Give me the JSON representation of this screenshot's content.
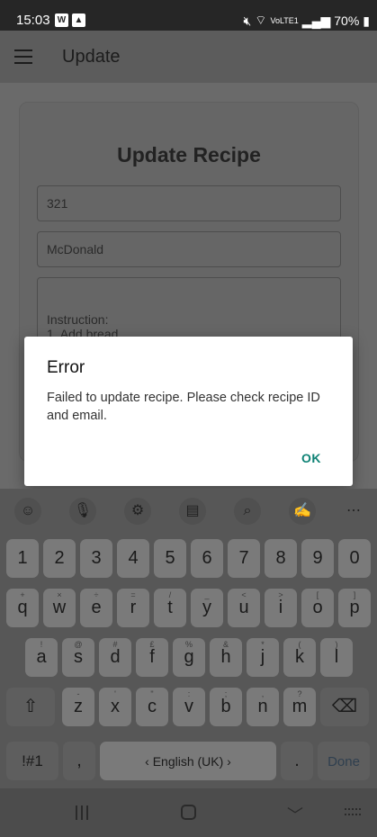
{
  "status_bar": {
    "time": "15:03",
    "left_icons": [
      "app-notification-icon",
      "gallery-icon"
    ],
    "volte": "VoLTE1",
    "battery": "70%"
  },
  "app_bar": {
    "title": "Update"
  },
  "form": {
    "heading": "Update Recipe",
    "recipe_id": "321",
    "email": "McDonald",
    "instructions_line1": "Instruction:",
    "instructions_line2": "1. Add bread"
  },
  "dialog": {
    "title": "Error",
    "message": "Failed to update recipe. Please check recipe ID and email.",
    "ok_label": "OK"
  },
  "keyboard": {
    "toolbar": [
      "emoji-icon",
      "mic-icon",
      "settings-icon",
      "clipboard-icon",
      "search-icon",
      "handwriting-icon",
      "more-icon"
    ],
    "number_row": [
      "1",
      "2",
      "3",
      "4",
      "5",
      "6",
      "7",
      "8",
      "9",
      "0"
    ],
    "row1": [
      [
        "q",
        "+"
      ],
      [
        "w",
        "×"
      ],
      [
        "e",
        "÷"
      ],
      [
        "r",
        "="
      ],
      [
        "t",
        "/"
      ],
      [
        "y",
        "_"
      ],
      [
        "u",
        "<"
      ],
      [
        "i",
        ">"
      ],
      [
        "o",
        "["
      ],
      [
        "p",
        "]"
      ]
    ],
    "row2": [
      [
        "a",
        "!"
      ],
      [
        "s",
        "@"
      ],
      [
        "d",
        "#"
      ],
      [
        "f",
        "£"
      ],
      [
        "g",
        "%"
      ],
      [
        "h",
        "&"
      ],
      [
        "j",
        "*"
      ],
      [
        "k",
        "("
      ],
      [
        "l",
        ")"
      ]
    ],
    "row3": [
      [
        "z",
        "-"
      ],
      [
        "x",
        "'"
      ],
      [
        "c",
        "\""
      ],
      [
        "v",
        ":"
      ],
      [
        "b",
        ";"
      ],
      [
        "n",
        ","
      ],
      [
        "m",
        "?"
      ]
    ],
    "symbols_label": "!#1",
    "comma": ",",
    "space_label": "English (UK)",
    "period": ".",
    "done_label": "Done"
  }
}
